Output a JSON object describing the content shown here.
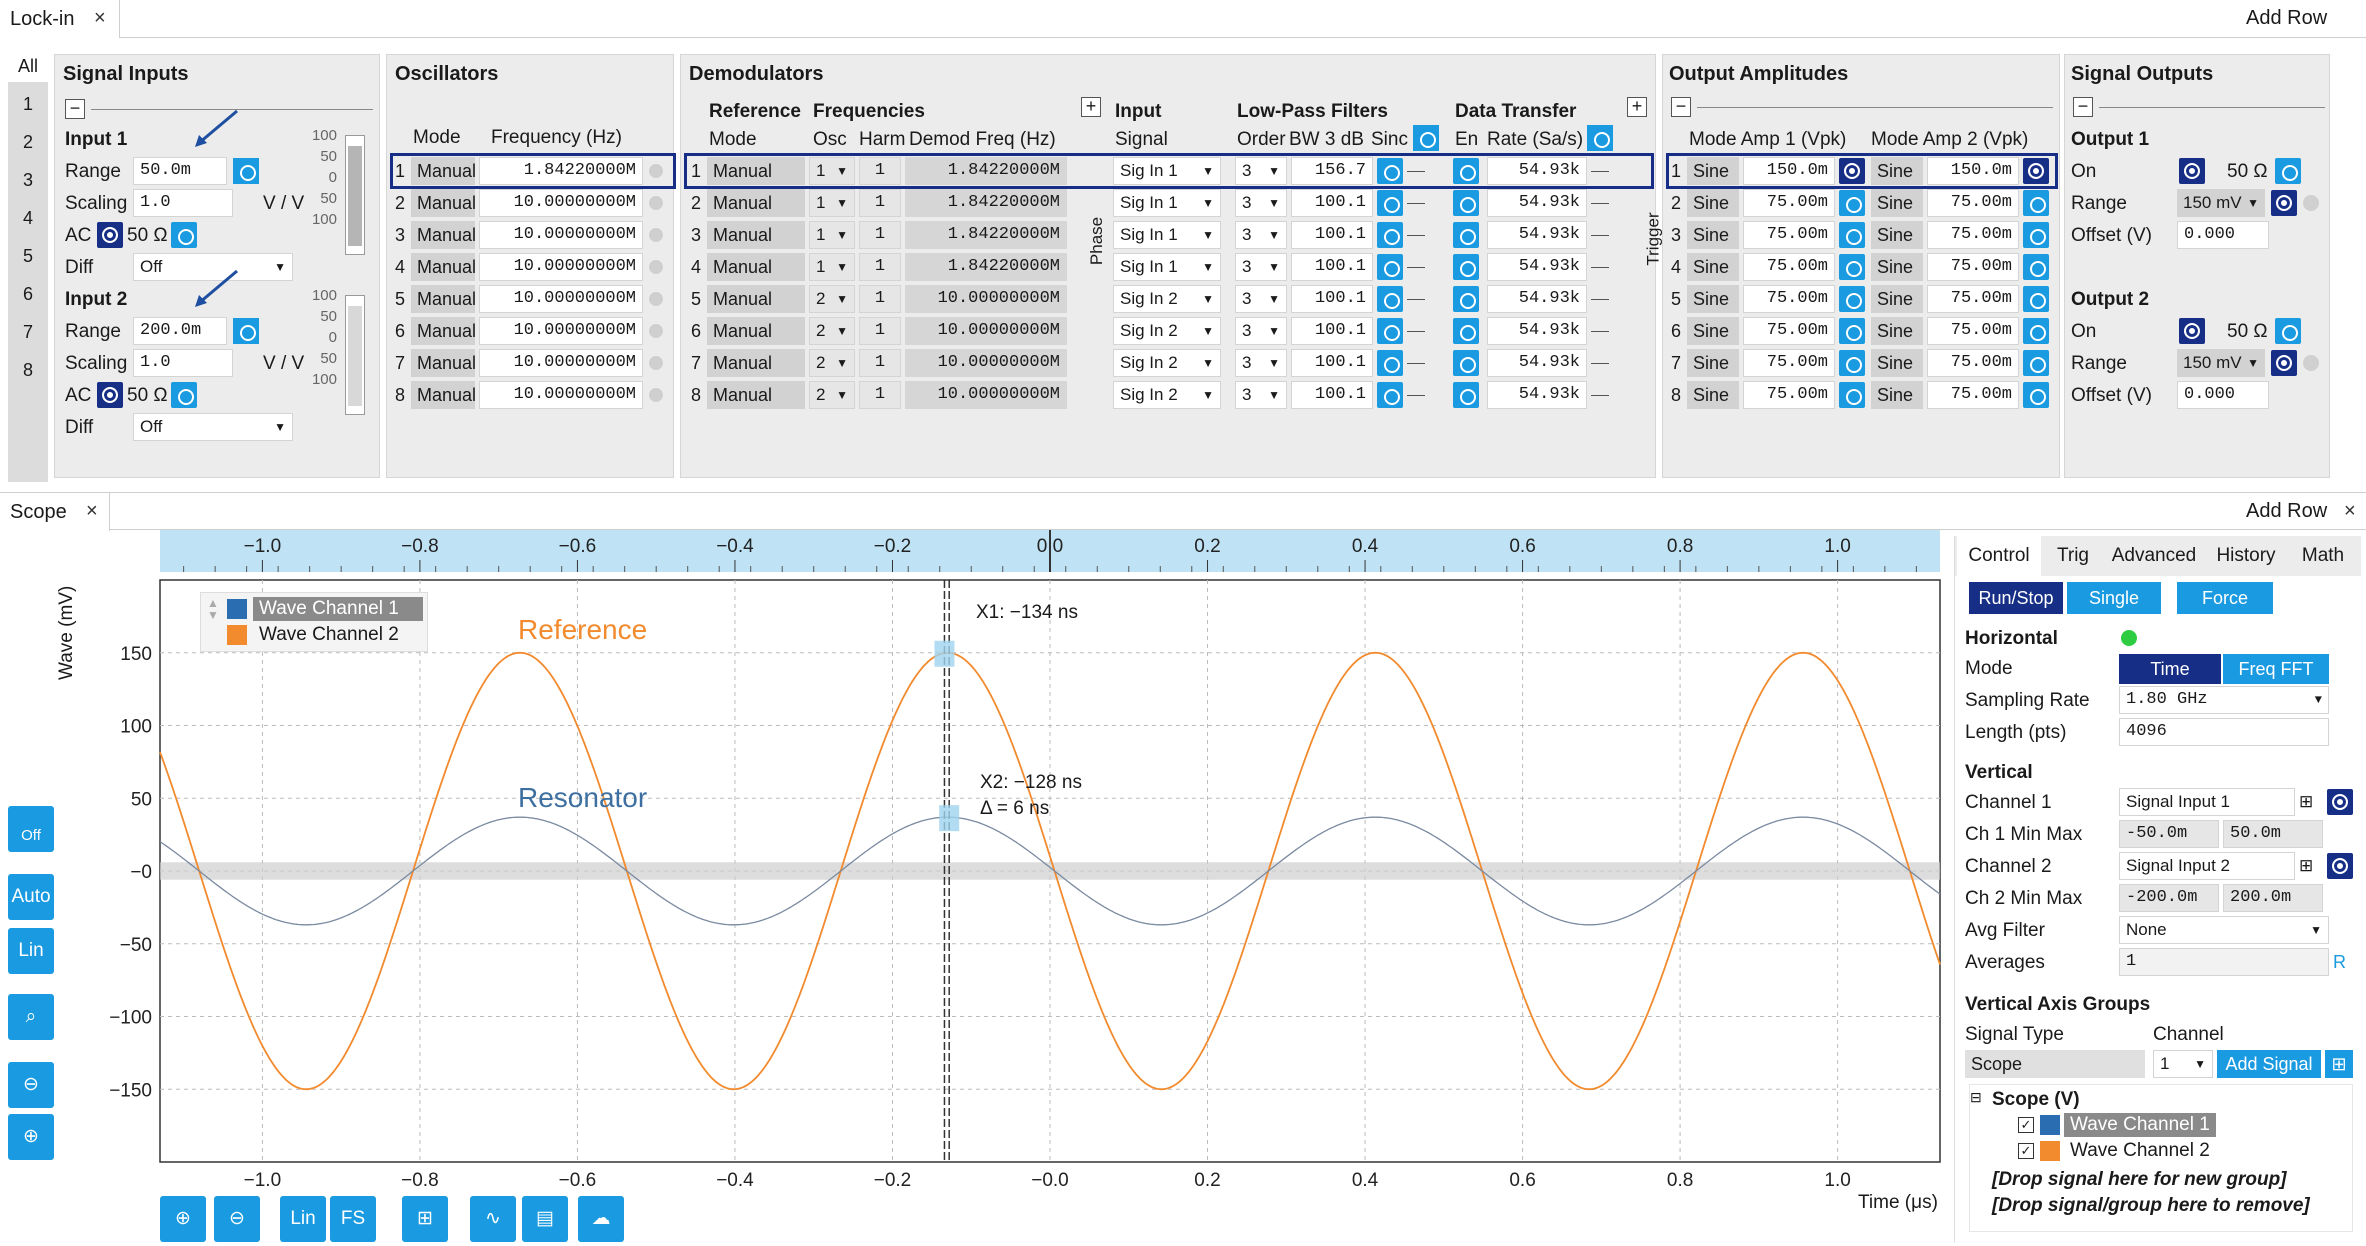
{
  "lockin": {
    "tab": "Lock-in",
    "add_row": "Add Row",
    "side_tabs": [
      "All",
      "1",
      "2",
      "3",
      "4",
      "5",
      "6",
      "7",
      "8"
    ]
  },
  "signal_inputs": {
    "title": "Signal Inputs",
    "input1": {
      "title": "Input 1",
      "range_label": "Range",
      "range": "50.0m",
      "scaling_label": "Scaling",
      "scaling": "1.0",
      "scaling_unit": "V / V",
      "ac": "AC",
      "ohm": "50 Ω",
      "diff_label": "Diff",
      "diff": "Off",
      "bar_ticks": [
        "100",
        "50",
        "0",
        "50",
        "100"
      ]
    },
    "input2": {
      "title": "Input 2",
      "range_label": "Range",
      "range": "200.0m",
      "scaling_label": "Scaling",
      "scaling": "1.0",
      "scaling_unit": "V / V",
      "ac": "AC",
      "ohm": "50 Ω",
      "diff_label": "Diff",
      "diff": "Off",
      "bar_ticks": [
        "100",
        "50",
        "0",
        "50",
        "100"
      ]
    }
  },
  "oscillators": {
    "title": "Oscillators",
    "col_mode": "Mode",
    "col_freq": "Frequency (Hz)",
    "rows": [
      {
        "n": "1",
        "mode": "Manual",
        "freq": "1.84220000M"
      },
      {
        "n": "2",
        "mode": "Manual",
        "freq": "10.00000000M"
      },
      {
        "n": "3",
        "mode": "Manual",
        "freq": "10.00000000M"
      },
      {
        "n": "4",
        "mode": "Manual",
        "freq": "10.00000000M"
      },
      {
        "n": "5",
        "mode": "Manual",
        "freq": "10.00000000M"
      },
      {
        "n": "6",
        "mode": "Manual",
        "freq": "10.00000000M"
      },
      {
        "n": "7",
        "mode": "Manual",
        "freq": "10.00000000M"
      },
      {
        "n": "8",
        "mode": "Manual",
        "freq": "10.00000000M"
      }
    ]
  },
  "demodulators": {
    "title": "Demodulators",
    "ref_label": "Reference",
    "freqs_label": "Frequencies",
    "col_mode": "Mode",
    "col_osc": "Osc",
    "col_harm": "Harm",
    "col_demod": "Demod Freq (Hz)",
    "phase": "Phase",
    "input_label": "Input",
    "signal_label": "Signal",
    "lpf_label": "Low-Pass Filters",
    "order_label": "Order",
    "bw_label": "BW 3 dB",
    "sinc_label": "Sinc",
    "dt_label": "Data Transfer",
    "en_label": "En",
    "rate_label": "Rate (Sa/s)",
    "trigger": "Trigger",
    "rows": [
      {
        "n": "1",
        "mode": "Manual",
        "osc": "1",
        "harm": "1",
        "freq": "1.84220000M",
        "signal": "Sig In 1",
        "order": "3",
        "bw": "156.7",
        "rate": "54.93k"
      },
      {
        "n": "2",
        "mode": "Manual",
        "osc": "1",
        "harm": "1",
        "freq": "1.84220000M",
        "signal": "Sig In 1",
        "order": "3",
        "bw": "100.1",
        "rate": "54.93k"
      },
      {
        "n": "3",
        "mode": "Manual",
        "osc": "1",
        "harm": "1",
        "freq": "1.84220000M",
        "signal": "Sig In 1",
        "order": "3",
        "bw": "100.1",
        "rate": "54.93k"
      },
      {
        "n": "4",
        "mode": "Manual",
        "osc": "1",
        "harm": "1",
        "freq": "1.84220000M",
        "signal": "Sig In 1",
        "order": "3",
        "bw": "100.1",
        "rate": "54.93k"
      },
      {
        "n": "5",
        "mode": "Manual",
        "osc": "2",
        "harm": "1",
        "freq": "10.00000000M",
        "signal": "Sig In 2",
        "order": "3",
        "bw": "100.1",
        "rate": "54.93k"
      },
      {
        "n": "6",
        "mode": "Manual",
        "osc": "2",
        "harm": "1",
        "freq": "10.00000000M",
        "signal": "Sig In 2",
        "order": "3",
        "bw": "100.1",
        "rate": "54.93k"
      },
      {
        "n": "7",
        "mode": "Manual",
        "osc": "2",
        "harm": "1",
        "freq": "10.00000000M",
        "signal": "Sig In 2",
        "order": "3",
        "bw": "100.1",
        "rate": "54.93k"
      },
      {
        "n": "8",
        "mode": "Manual",
        "osc": "2",
        "harm": "1",
        "freq": "10.00000000M",
        "signal": "Sig In 2",
        "order": "3",
        "bw": "100.1",
        "rate": "54.93k"
      }
    ]
  },
  "output_amplitudes": {
    "title": "Output Amplitudes",
    "col1": "Mode Amp 1 (Vpk)",
    "col2": "Mode Amp 2 (Vpk)",
    "rows": [
      {
        "n": "1",
        "m1": "Sine",
        "a1": "150.0m",
        "m2": "Sine",
        "a2": "150.0m"
      },
      {
        "n": "2",
        "m1": "Sine",
        "a1": "75.00m",
        "m2": "Sine",
        "a2": "75.00m"
      },
      {
        "n": "3",
        "m1": "Sine",
        "a1": "75.00m",
        "m2": "Sine",
        "a2": "75.00m"
      },
      {
        "n": "4",
        "m1": "Sine",
        "a1": "75.00m",
        "m2": "Sine",
        "a2": "75.00m"
      },
      {
        "n": "5",
        "m1": "Sine",
        "a1": "75.00m",
        "m2": "Sine",
        "a2": "75.00m"
      },
      {
        "n": "6",
        "m1": "Sine",
        "a1": "75.00m",
        "m2": "Sine",
        "a2": "75.00m"
      },
      {
        "n": "7",
        "m1": "Sine",
        "a1": "75.00m",
        "m2": "Sine",
        "a2": "75.00m"
      },
      {
        "n": "8",
        "m1": "Sine",
        "a1": "75.00m",
        "m2": "Sine",
        "a2": "75.00m"
      }
    ]
  },
  "signal_outputs": {
    "title": "Signal Outputs",
    "out1": {
      "title": "Output 1",
      "on": "On",
      "ohm": "50 Ω",
      "range_label": "Range",
      "range": "150 mV",
      "offset_label": "Offset (V)",
      "offset": "0.000"
    },
    "out2": {
      "title": "Output 2",
      "on": "On",
      "ohm": "50 Ω",
      "range_label": "Range",
      "range": "150 mV",
      "offset_label": "Offset (V)",
      "offset": "0.000"
    }
  },
  "scope": {
    "tab": "Scope",
    "add_row": "Add Row",
    "ylabel": "Wave (mV)",
    "xlabel": "Time (μs)",
    "legend": [
      "Wave Channel 1",
      "Wave Channel 2"
    ],
    "ann_reference": "Reference",
    "ann_resonator": "Resonator",
    "cursor1": "X1: −134 ns",
    "cursor2": "X2: −128 ns",
    "delta": "Δ = 6 ns",
    "tools_left": [
      "Off",
      "Auto",
      "Lin"
    ],
    "tools_bottom": [
      "Lin",
      "FS"
    ]
  },
  "chart_data": {
    "type": "line",
    "xlabel": "Time (μs)",
    "ylabel": "Wave (mV)",
    "xlim": [
      -1.13,
      1.13
    ],
    "ylim": [
      -200,
      200
    ],
    "xticks": [
      "−1.0",
      "−0.8",
      "−0.6",
      "−0.4",
      "−0.2",
      "−0.0",
      "0.2",
      "0.4",
      "0.6",
      "0.8",
      "1.0"
    ],
    "xticks_top": [
      "−1.0",
      "−0.8",
      "−0.6",
      "−0.4",
      "−0.2",
      "0.0",
      "0.2",
      "0.4",
      "0.6",
      "0.8",
      "1.0"
    ],
    "yticks": [
      "150",
      "100",
      "50",
      "−0",
      "−50",
      "−100",
      "−150"
    ],
    "series": [
      {
        "name": "Wave Channel 2",
        "color": "#f28a2e",
        "amplitude": 150,
        "period_us": 0.543,
        "peak_at_us": -0.13
      },
      {
        "name": "Wave Channel 1",
        "color": "#7a8aa0",
        "amplitude": 37,
        "period_us": 0.543,
        "peak_at_us": -0.13
      }
    ],
    "cursors_us": [
      -0.134,
      -0.128
    ]
  },
  "control": {
    "tabs": [
      "Control",
      "Trig",
      "Advanced",
      "History",
      "Math"
    ],
    "run": "Run/Stop",
    "single": "Single",
    "force": "Force",
    "horizontal": "Horizontal",
    "mode_label": "Mode",
    "mode_time": "Time",
    "mode_fft": "Freq FFT",
    "rate_label": "Sampling Rate",
    "rate": "1.80 GHz",
    "length_label": "Length (pts)",
    "length": "4096",
    "vertical": "Vertical",
    "ch1_label": "Channel 1",
    "ch1": "Signal Input 1",
    "ch1mm_label": "Ch 1 Min Max",
    "ch1min": "-50.0m",
    "ch1max": "50.0m",
    "ch2_label": "Channel 2",
    "ch2": "Signal Input 2",
    "ch2mm_label": "Ch 2 Min Max",
    "ch2min": "-200.0m",
    "ch2max": "200.0m",
    "avg_label": "Avg Filter",
    "avg": "None",
    "averages_label": "Averages",
    "averages": "1",
    "r": "R",
    "vag": "Vertical Axis Groups",
    "sigtype_label": "Signal Type",
    "channel_label": "Channel",
    "sigtype": "Scope",
    "channel": "1",
    "add_signal": "Add Signal",
    "tree_root": "Scope (V)",
    "tree_items": [
      "Wave Channel 1",
      "Wave Channel 2"
    ],
    "drop1": "[Drop signal here for new group]",
    "drop2": "[Drop signal/group here to remove]"
  }
}
